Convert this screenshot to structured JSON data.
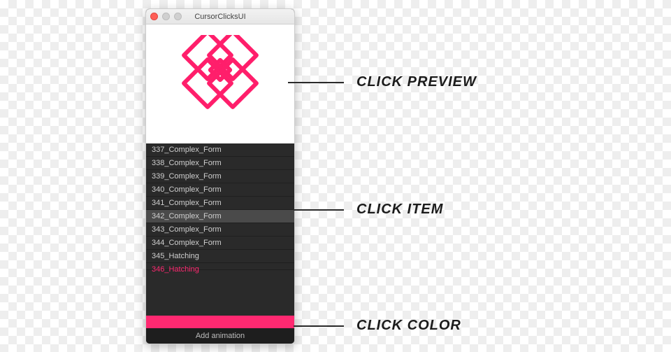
{
  "window": {
    "title": "CursorClicksUI"
  },
  "colors": {
    "accent": "#ff2971"
  },
  "preview": {
    "name": "complex-form-342"
  },
  "list": {
    "selected_index": 5,
    "items": [
      {
        "label": "337_Complex_Form"
      },
      {
        "label": "338_Complex_Form"
      },
      {
        "label": "339_Complex_Form"
      },
      {
        "label": "340_Complex_Form"
      },
      {
        "label": "341_Complex_Form"
      },
      {
        "label": "342_Complex_Form"
      },
      {
        "label": "343_Complex_Form"
      },
      {
        "label": "344_Complex_Form"
      },
      {
        "label": "345_Hatching"
      },
      {
        "label": "346_Hatching"
      }
    ]
  },
  "footer": {
    "button_label": "Add animation"
  },
  "callouts": {
    "preview": "CLICK PREVIEW",
    "item": "CLICK ITEM",
    "color": "CLICK COLOR"
  }
}
